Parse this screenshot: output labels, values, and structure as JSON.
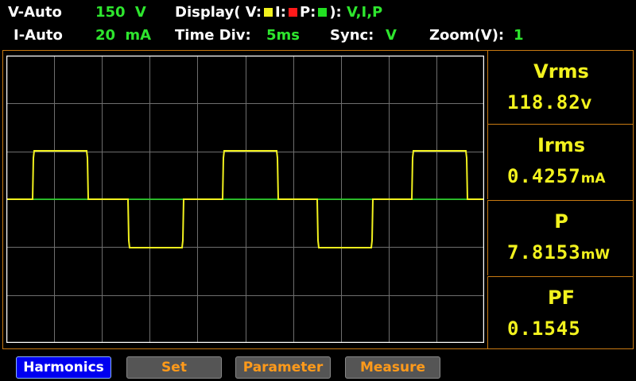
{
  "header": {
    "v_range_label": "V-Auto",
    "v_range_value": "150 V",
    "display_label": "Display( V:",
    "display_i_label": "I:",
    "display_p_label": "P:",
    "display_close": "):",
    "display_value": "V,I,P",
    "i_range_label": "I-Auto",
    "i_range_value": "20 mA",
    "time_div_label": "Time  Div:",
    "time_div_value": "5ms",
    "sync_label": "Sync:",
    "sync_value": "V",
    "zoom_label": "Zoom(V):",
    "zoom_value": "1",
    "colors": {
      "v": "#f2f21e",
      "i": "#ff1a1a",
      "p": "#22e022"
    }
  },
  "readings": [
    {
      "name": "Vrms",
      "value": "118.82",
      "unit": "V"
    },
    {
      "name": "Irms",
      "value": "0.4257",
      "unit": "mA"
    },
    {
      "name": "P",
      "value": "7.8153",
      "unit": "mW"
    },
    {
      "name": "PF",
      "value": "0.1545",
      "unit": ""
    }
  ],
  "buttons": {
    "harmonics": "Harmonics",
    "set": "Set",
    "parameter": "Parameter",
    "measure": "Measure"
  },
  "waveform": {
    "trace_color": "#f2f21e",
    "baseline_color": "#22e022",
    "grid_color": "#6e6e6e"
  }
}
